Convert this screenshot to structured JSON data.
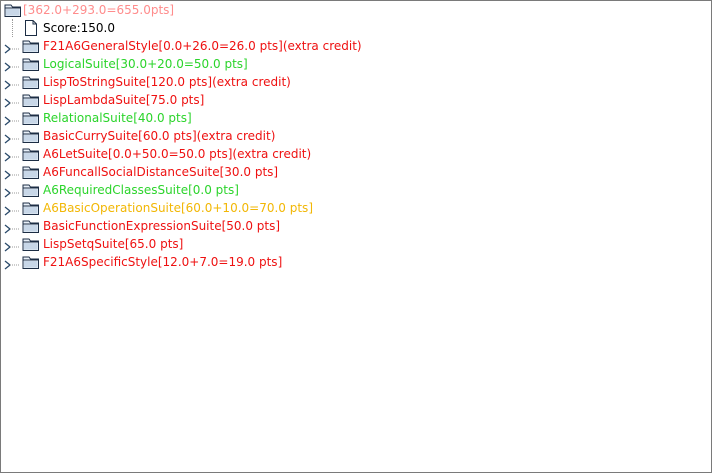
{
  "colors": {
    "root": "#ff8c8c",
    "score": "#000000",
    "red": "#ee1111",
    "green": "#2bd42b",
    "orange": "#f2b705"
  },
  "tree": {
    "root": {
      "label": "[362.0+293.0=655.0pts]",
      "icon": "folder-icon"
    },
    "score": {
      "label": "Score:150.0",
      "icon": "document-icon"
    },
    "suites": [
      {
        "label": "F21A6GeneralStyle[0.0+26.0=26.0 pts](extra credit)",
        "color": "red"
      },
      {
        "label": "LogicalSuite[30.0+20.0=50.0 pts]",
        "color": "green"
      },
      {
        "label": "LispToStringSuite[120.0 pts](extra credit)",
        "color": "red"
      },
      {
        "label": "LispLambdaSuite[75.0 pts]",
        "color": "red"
      },
      {
        "label": "RelationalSuite[40.0 pts]",
        "color": "green"
      },
      {
        "label": "BasicCurrySuite[60.0 pts](extra credit)",
        "color": "red"
      },
      {
        "label": "A6LetSuite[0.0+50.0=50.0 pts](extra credit)",
        "color": "red"
      },
      {
        "label": "A6FuncallSocialDistanceSuite[30.0 pts]",
        "color": "red"
      },
      {
        "label": "A6RequiredClassesSuite[0.0 pts]",
        "color": "green"
      },
      {
        "label": "A6BasicOperationSuite[60.0+10.0=70.0 pts]",
        "color": "orange"
      },
      {
        "label": "BasicFunctionExpressionSuite[50.0 pts]",
        "color": "red"
      },
      {
        "label": "LispSetqSuite[65.0 pts]",
        "color": "red"
      },
      {
        "label": "F21A6SpecificStyle[12.0+7.0=19.0 pts]",
        "color": "red"
      }
    ]
  }
}
